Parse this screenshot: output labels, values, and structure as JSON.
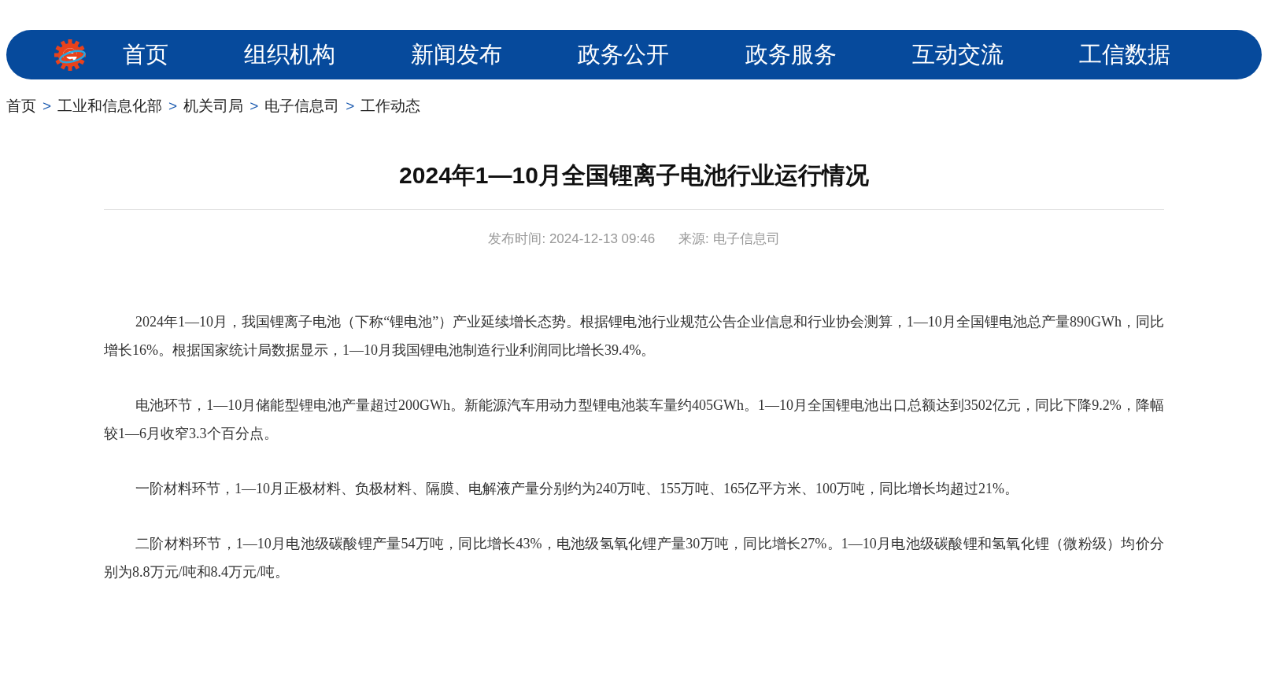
{
  "nav": {
    "items": [
      "首页",
      "组织机构",
      "新闻发布",
      "政务公开",
      "政务服务",
      "互动交流",
      "工信数据"
    ]
  },
  "breadcrumb": {
    "items": [
      "首页",
      "工业和信息化部",
      "机关司局",
      "电子信息司",
      "工作动态"
    ],
    "separators": [
      ">",
      ">",
      ">",
      ">"
    ]
  },
  "article": {
    "title": "2024年1—10月全国锂离子电池行业运行情况",
    "meta": [
      {
        "label": "发布时间:",
        "value": "2024-12-13 09:46"
      },
      {
        "label": "来源:",
        "value": "电子信息司"
      }
    ],
    "paragraphs": [
      "2024年1—10月，我国锂离子电池（下称“锂电池”）产业延续增长态势。根据锂电池行业规范公告企业信息和行业协会测算，1—10月全国锂电池总产量890GWh，同比增长16%。根据国家统计局数据显示，1—10月我国锂电池制造行业利润同比增长39.4%。",
      "电池环节，1—10月储能型锂电池产量超过200GWh。新能源汽车用动力型锂电池装车量约405GWh。1—10月全国锂电池出口总额达到3502亿元，同比下降9.2%，降幅较1—6月收窄3.3个百分点。",
      "一阶材料环节，1—10月正极材料、负极材料、隔膜、电解液产量分别约为240万吨、155万吨、165亿平方米、100万吨，同比增长均超过21%。",
      "二阶材料环节，1—10月电池级碳酸锂产量54万吨，同比增长43%，电池级氢氧化锂产量30万吨，同比增长27%。1—10月电池级碳酸锂和氢氧化锂（微粉级）均价分别为8.8万元/吨和8.4万元/吨。"
    ]
  }
}
